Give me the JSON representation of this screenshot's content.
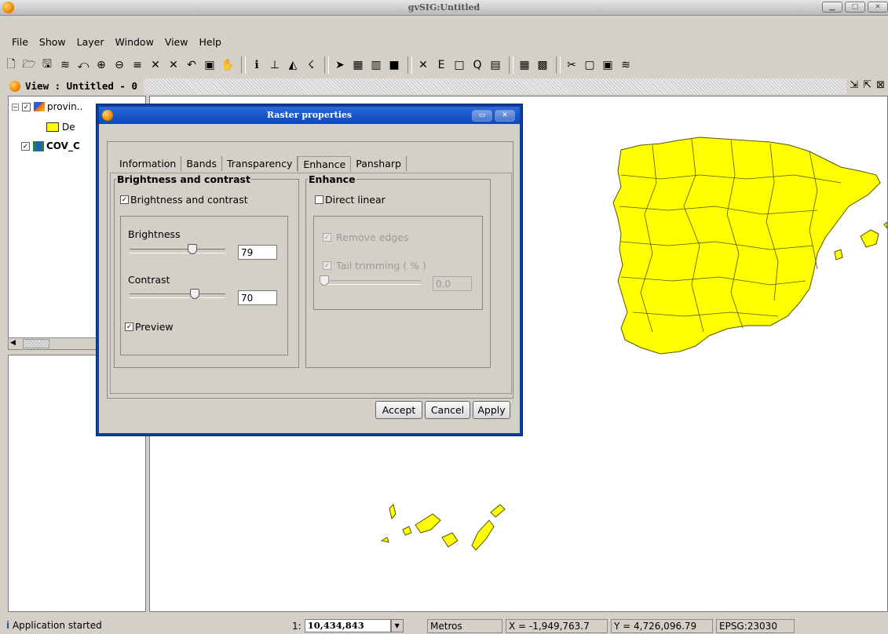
{
  "app": {
    "title": "gvSIG:Untitled"
  },
  "menu": [
    "File",
    "Show",
    "Layer",
    "Window",
    "View",
    "Help"
  ],
  "view": {
    "title": "View : Untitled - 0"
  },
  "toc": {
    "layers": [
      {
        "name": "provin..",
        "checked": true
      },
      {
        "name": "De",
        "legend": true
      },
      {
        "name": "COV_C",
        "checked": true
      }
    ]
  },
  "dialog": {
    "title": "Raster properties",
    "tabs": [
      "Information",
      "Bands",
      "Transparency",
      "Enhance",
      "Pansharp"
    ],
    "active_tab": "Enhance",
    "brightness_group": {
      "legend": "Brightness and contrast",
      "checkbox_label": "Brightness and contrast",
      "brightness_label": "Brightness",
      "brightness_value": "79",
      "contrast_label": "Contrast",
      "contrast_value": "70",
      "preview_label": "Preview"
    },
    "enhance_group": {
      "legend": "Enhance",
      "direct_linear_label": "Direct linear",
      "remove_edges_label": "Remove edges",
      "tail_trimming_label": "Tail trimming ( % )",
      "tail_value": "0.0"
    },
    "buttons": {
      "accept": "Accept",
      "cancel": "Cancel",
      "apply": "Apply"
    }
  },
  "status": {
    "message": "Application started",
    "scale_prefix": "1:",
    "scale": "10,434,843",
    "units": "Metros",
    "x": "X = -1,949,763.7",
    "y": "Y = 4,726,096.79",
    "epsg": "EPSG:23030"
  },
  "colors": {
    "map_fill": "#ffff00",
    "map_stroke": "#555500",
    "dialog_frame": "#0a3ea0"
  }
}
